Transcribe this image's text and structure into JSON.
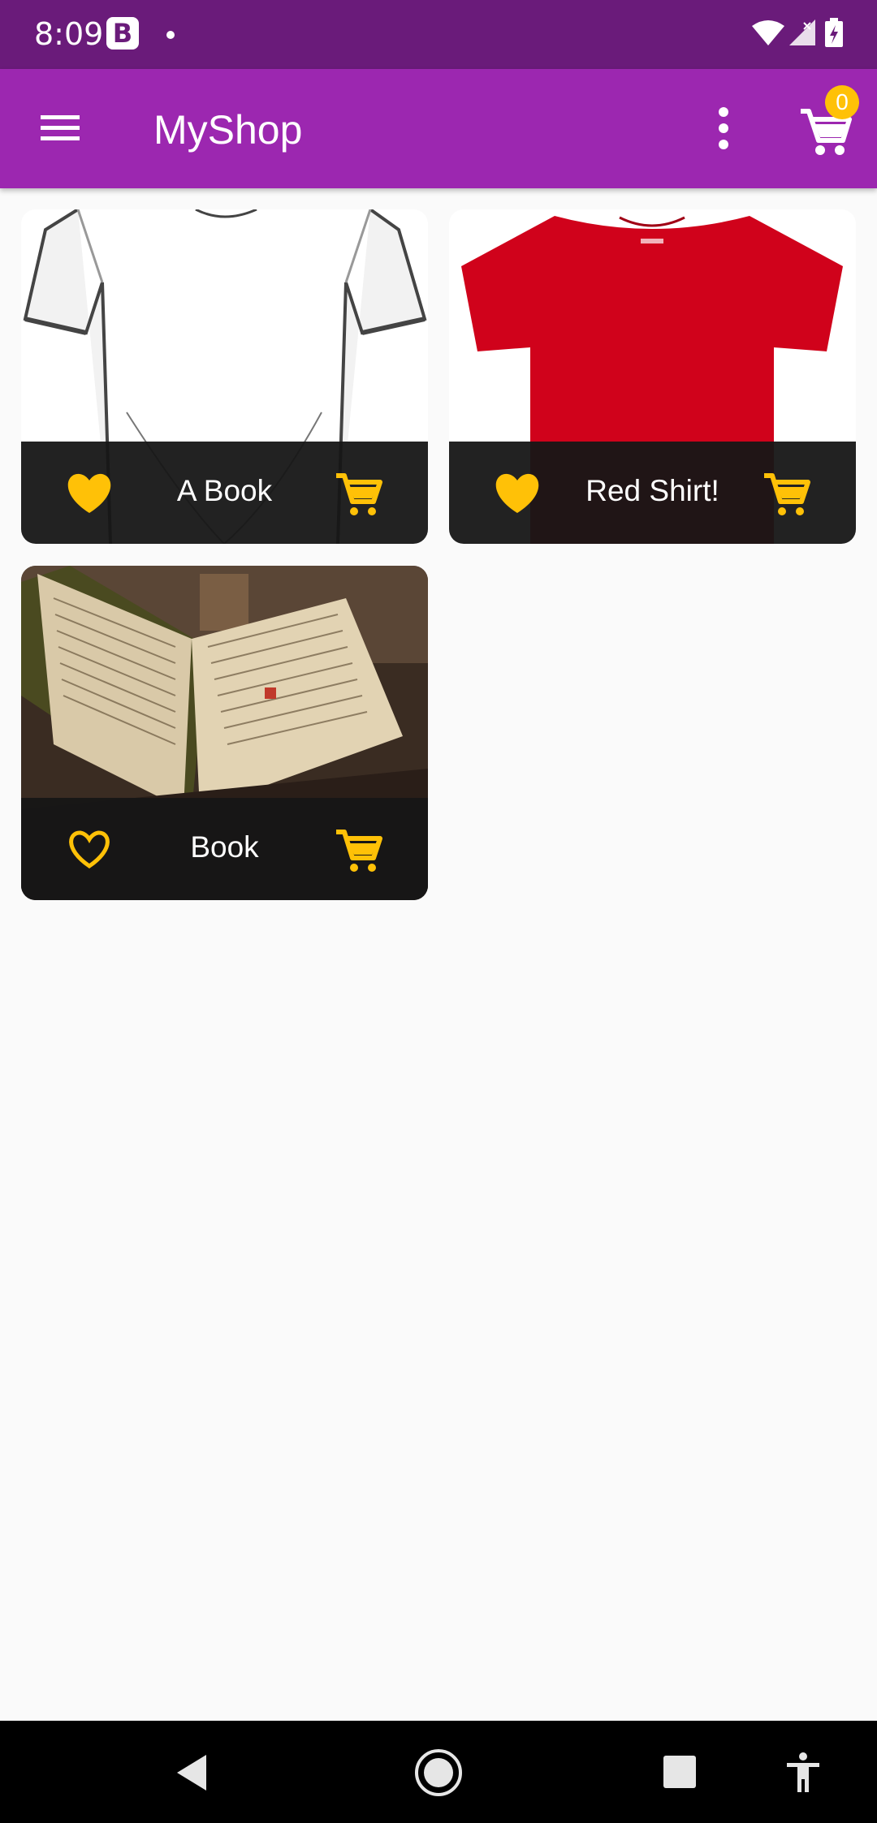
{
  "status_bar": {
    "time": "8:09",
    "app_badge": "B",
    "icons": [
      "wifi-icon",
      "signal-icon",
      "battery-charging-icon"
    ]
  },
  "app_bar": {
    "title": "MyShop",
    "cart_count": "0",
    "icons": [
      "menu-icon",
      "overflow-menu-icon",
      "cart-icon"
    ]
  },
  "products": [
    {
      "title": "A Book",
      "favorited": true,
      "image": "white-shirt-sketch",
      "icons": [
        "heart-filled-icon",
        "add-to-cart-icon"
      ]
    },
    {
      "title": "Red Shirt!",
      "favorited": true,
      "image": "red-tshirt",
      "icons": [
        "heart-filled-icon",
        "add-to-cart-icon"
      ]
    },
    {
      "title": "Book",
      "favorited": false,
      "image": "open-old-book",
      "icons": [
        "heart-outline-icon",
        "add-to-cart-icon"
      ]
    }
  ],
  "colors": {
    "status_bar": "#6a1b7a",
    "app_bar": "#9c27b0",
    "accent": "#ffc107",
    "background": "#fafafa",
    "card_footer": "#161616"
  },
  "nav_bar": {
    "icons": [
      "back-icon",
      "home-icon",
      "recents-icon",
      "accessibility-icon"
    ]
  }
}
